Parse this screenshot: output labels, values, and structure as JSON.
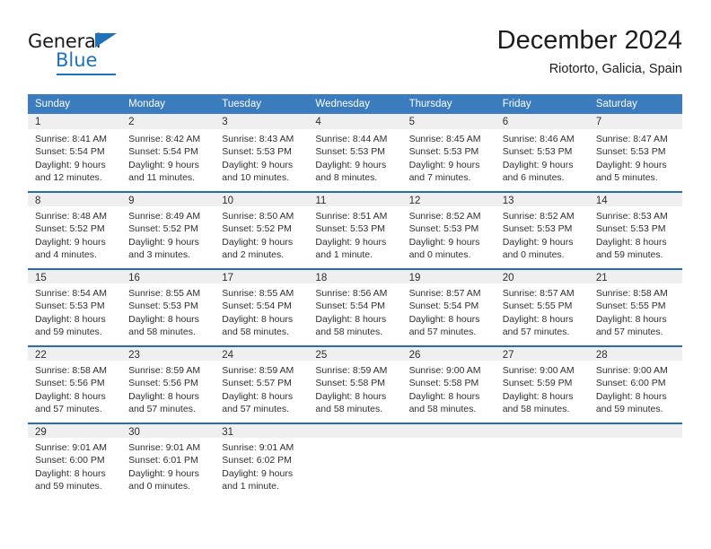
{
  "brand": {
    "name_part1": "General",
    "name_part2": "Blue",
    "logo_icon": "triangle-icon",
    "accent_color": "#1f72b8"
  },
  "header": {
    "title": "December 2024",
    "subtitle": "Riotorto, Galicia, Spain"
  },
  "colors": {
    "header_blue": "#3a7cbe",
    "row_rule_blue": "#2a6cb0",
    "daynum_band": "#efefef",
    "text": "#2f2f2f"
  },
  "weekday_headers": [
    "Sunday",
    "Monday",
    "Tuesday",
    "Wednesday",
    "Thursday",
    "Friday",
    "Saturday"
  ],
  "weeks": [
    [
      {
        "day": "1",
        "sunrise": "Sunrise: 8:41 AM",
        "sunset": "Sunset: 5:54 PM",
        "daylight_line1": "Daylight: 9 hours",
        "daylight_line2": "and 12 minutes."
      },
      {
        "day": "2",
        "sunrise": "Sunrise: 8:42 AM",
        "sunset": "Sunset: 5:54 PM",
        "daylight_line1": "Daylight: 9 hours",
        "daylight_line2": "and 11 minutes."
      },
      {
        "day": "3",
        "sunrise": "Sunrise: 8:43 AM",
        "sunset": "Sunset: 5:53 PM",
        "daylight_line1": "Daylight: 9 hours",
        "daylight_line2": "and 10 minutes."
      },
      {
        "day": "4",
        "sunrise": "Sunrise: 8:44 AM",
        "sunset": "Sunset: 5:53 PM",
        "daylight_line1": "Daylight: 9 hours",
        "daylight_line2": "and 8 minutes."
      },
      {
        "day": "5",
        "sunrise": "Sunrise: 8:45 AM",
        "sunset": "Sunset: 5:53 PM",
        "daylight_line1": "Daylight: 9 hours",
        "daylight_line2": "and 7 minutes."
      },
      {
        "day": "6",
        "sunrise": "Sunrise: 8:46 AM",
        "sunset": "Sunset: 5:53 PM",
        "daylight_line1": "Daylight: 9 hours",
        "daylight_line2": "and 6 minutes."
      },
      {
        "day": "7",
        "sunrise": "Sunrise: 8:47 AM",
        "sunset": "Sunset: 5:53 PM",
        "daylight_line1": "Daylight: 9 hours",
        "daylight_line2": "and 5 minutes."
      }
    ],
    [
      {
        "day": "8",
        "sunrise": "Sunrise: 8:48 AM",
        "sunset": "Sunset: 5:52 PM",
        "daylight_line1": "Daylight: 9 hours",
        "daylight_line2": "and 4 minutes."
      },
      {
        "day": "9",
        "sunrise": "Sunrise: 8:49 AM",
        "sunset": "Sunset: 5:52 PM",
        "daylight_line1": "Daylight: 9 hours",
        "daylight_line2": "and 3 minutes."
      },
      {
        "day": "10",
        "sunrise": "Sunrise: 8:50 AM",
        "sunset": "Sunset: 5:52 PM",
        "daylight_line1": "Daylight: 9 hours",
        "daylight_line2": "and 2 minutes."
      },
      {
        "day": "11",
        "sunrise": "Sunrise: 8:51 AM",
        "sunset": "Sunset: 5:53 PM",
        "daylight_line1": "Daylight: 9 hours",
        "daylight_line2": "and 1 minute."
      },
      {
        "day": "12",
        "sunrise": "Sunrise: 8:52 AM",
        "sunset": "Sunset: 5:53 PM",
        "daylight_line1": "Daylight: 9 hours",
        "daylight_line2": "and 0 minutes."
      },
      {
        "day": "13",
        "sunrise": "Sunrise: 8:52 AM",
        "sunset": "Sunset: 5:53 PM",
        "daylight_line1": "Daylight: 9 hours",
        "daylight_line2": "and 0 minutes."
      },
      {
        "day": "14",
        "sunrise": "Sunrise: 8:53 AM",
        "sunset": "Sunset: 5:53 PM",
        "daylight_line1": "Daylight: 8 hours",
        "daylight_line2": "and 59 minutes."
      }
    ],
    [
      {
        "day": "15",
        "sunrise": "Sunrise: 8:54 AM",
        "sunset": "Sunset: 5:53 PM",
        "daylight_line1": "Daylight: 8 hours",
        "daylight_line2": "and 59 minutes."
      },
      {
        "day": "16",
        "sunrise": "Sunrise: 8:55 AM",
        "sunset": "Sunset: 5:53 PM",
        "daylight_line1": "Daylight: 8 hours",
        "daylight_line2": "and 58 minutes."
      },
      {
        "day": "17",
        "sunrise": "Sunrise: 8:55 AM",
        "sunset": "Sunset: 5:54 PM",
        "daylight_line1": "Daylight: 8 hours",
        "daylight_line2": "and 58 minutes."
      },
      {
        "day": "18",
        "sunrise": "Sunrise: 8:56 AM",
        "sunset": "Sunset: 5:54 PM",
        "daylight_line1": "Daylight: 8 hours",
        "daylight_line2": "and 58 minutes."
      },
      {
        "day": "19",
        "sunrise": "Sunrise: 8:57 AM",
        "sunset": "Sunset: 5:54 PM",
        "daylight_line1": "Daylight: 8 hours",
        "daylight_line2": "and 57 minutes."
      },
      {
        "day": "20",
        "sunrise": "Sunrise: 8:57 AM",
        "sunset": "Sunset: 5:55 PM",
        "daylight_line1": "Daylight: 8 hours",
        "daylight_line2": "and 57 minutes."
      },
      {
        "day": "21",
        "sunrise": "Sunrise: 8:58 AM",
        "sunset": "Sunset: 5:55 PM",
        "daylight_line1": "Daylight: 8 hours",
        "daylight_line2": "and 57 minutes."
      }
    ],
    [
      {
        "day": "22",
        "sunrise": "Sunrise: 8:58 AM",
        "sunset": "Sunset: 5:56 PM",
        "daylight_line1": "Daylight: 8 hours",
        "daylight_line2": "and 57 minutes."
      },
      {
        "day": "23",
        "sunrise": "Sunrise: 8:59 AM",
        "sunset": "Sunset: 5:56 PM",
        "daylight_line1": "Daylight: 8 hours",
        "daylight_line2": "and 57 minutes."
      },
      {
        "day": "24",
        "sunrise": "Sunrise: 8:59 AM",
        "sunset": "Sunset: 5:57 PM",
        "daylight_line1": "Daylight: 8 hours",
        "daylight_line2": "and 57 minutes."
      },
      {
        "day": "25",
        "sunrise": "Sunrise: 8:59 AM",
        "sunset": "Sunset: 5:58 PM",
        "daylight_line1": "Daylight: 8 hours",
        "daylight_line2": "and 58 minutes."
      },
      {
        "day": "26",
        "sunrise": "Sunrise: 9:00 AM",
        "sunset": "Sunset: 5:58 PM",
        "daylight_line1": "Daylight: 8 hours",
        "daylight_line2": "and 58 minutes."
      },
      {
        "day": "27",
        "sunrise": "Sunrise: 9:00 AM",
        "sunset": "Sunset: 5:59 PM",
        "daylight_line1": "Daylight: 8 hours",
        "daylight_line2": "and 58 minutes."
      },
      {
        "day": "28",
        "sunrise": "Sunrise: 9:00 AM",
        "sunset": "Sunset: 6:00 PM",
        "daylight_line1": "Daylight: 8 hours",
        "daylight_line2": "and 59 minutes."
      }
    ],
    [
      {
        "day": "29",
        "sunrise": "Sunrise: 9:01 AM",
        "sunset": "Sunset: 6:00 PM",
        "daylight_line1": "Daylight: 8 hours",
        "daylight_line2": "and 59 minutes."
      },
      {
        "day": "30",
        "sunrise": "Sunrise: 9:01 AM",
        "sunset": "Sunset: 6:01 PM",
        "daylight_line1": "Daylight: 9 hours",
        "daylight_line2": "and 0 minutes."
      },
      {
        "day": "31",
        "sunrise": "Sunrise: 9:01 AM",
        "sunset": "Sunset: 6:02 PM",
        "daylight_line1": "Daylight: 9 hours",
        "daylight_line2": "and 1 minute."
      },
      {
        "day": "",
        "sunrise": "",
        "sunset": "",
        "daylight_line1": "",
        "daylight_line2": ""
      },
      {
        "day": "",
        "sunrise": "",
        "sunset": "",
        "daylight_line1": "",
        "daylight_line2": ""
      },
      {
        "day": "",
        "sunrise": "",
        "sunset": "",
        "daylight_line1": "",
        "daylight_line2": ""
      },
      {
        "day": "",
        "sunrise": "",
        "sunset": "",
        "daylight_line1": "",
        "daylight_line2": ""
      }
    ]
  ]
}
